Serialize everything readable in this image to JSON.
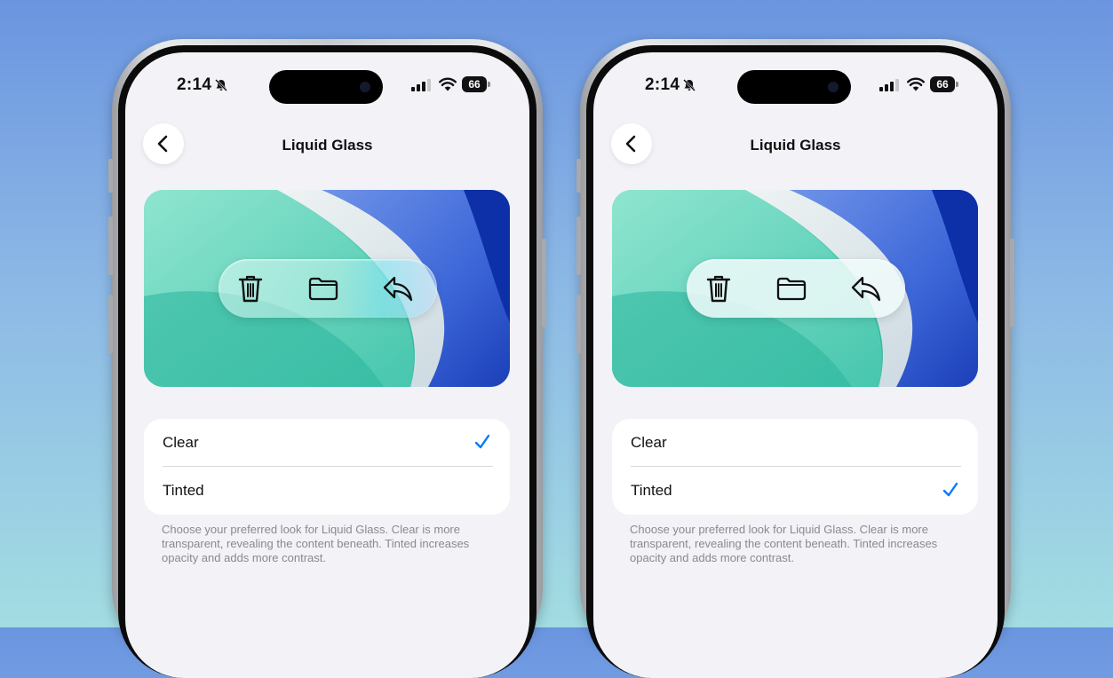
{
  "status_bar": {
    "time": "2:14",
    "battery": "66",
    "silent_icon": "bell-slash-icon",
    "signal_icon": "cellular-signal-icon",
    "wifi_icon": "wifi-icon"
  },
  "nav": {
    "title": "Liquid Glass",
    "back_icon": "chevron-left-icon"
  },
  "preview": {
    "icons": [
      "trash-icon",
      "folder-icon",
      "reply-icon"
    ]
  },
  "options": [
    {
      "label": "Clear"
    },
    {
      "label": "Tinted"
    }
  ],
  "footnote": "Choose your preferred look for Liquid Glass. Clear is more transparent, revealing the content beneath. Tinted increases opacity and adds more contrast.",
  "phones": [
    {
      "selected_option": "Clear",
      "glass_style": "clear"
    },
    {
      "selected_option": "Tinted",
      "glass_style": "tinted"
    }
  ],
  "colors": {
    "accent": "#007aff",
    "background_top": "#6b95e0",
    "background_bottom": "#a3dde2"
  }
}
